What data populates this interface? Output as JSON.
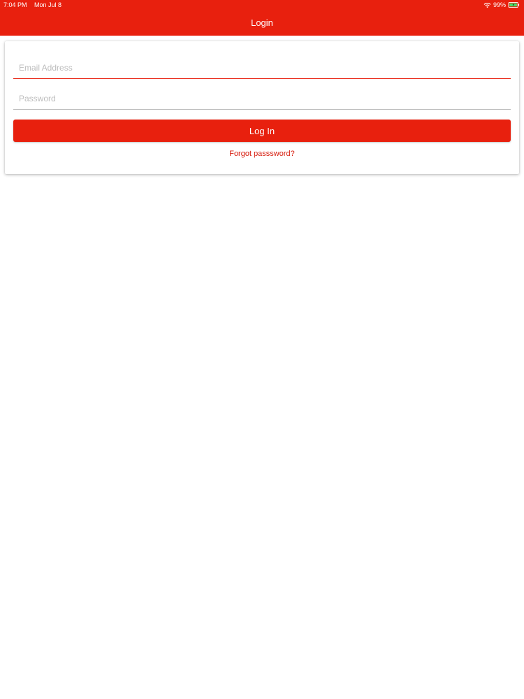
{
  "status_bar": {
    "time": "7:04 PM",
    "date": "Mon Jul 8",
    "battery": "99%"
  },
  "header": {
    "title": "Login"
  },
  "login_form": {
    "email_placeholder": "Email Address",
    "email_value": "",
    "password_placeholder": "Password",
    "password_value": "",
    "login_label": "Log In",
    "forgot_label": "Forgot passsword?"
  },
  "colors": {
    "accent": "#e8200e",
    "link": "#d61b0c",
    "placeholder": "#bdbdbd"
  },
  "icons": {
    "wifi": "wifi-icon",
    "battery": "battery-icon"
  }
}
